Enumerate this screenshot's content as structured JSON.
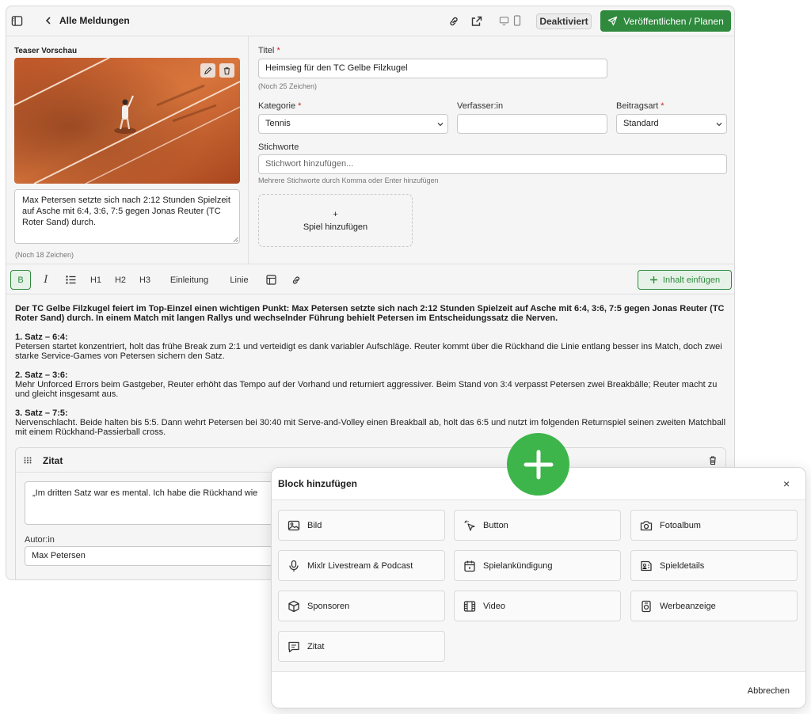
{
  "header": {
    "back_title": "Alle Meldungen",
    "deactivate_label": "Deaktiviert",
    "publish_label": "Veröffentlichen / Planen"
  },
  "teaser": {
    "heading": "Teaser Vorschau",
    "text": "Max Petersen setzte sich nach 2:12 Stunden Spielzeit auf Asche mit 6:4, 3:6, 7:5 gegen Jonas Reuter (TC Roter Sand) durch.",
    "remaining": "(Noch 18 Zeichen)"
  },
  "form": {
    "title_label": "Titel",
    "title_value": "Heimsieg für den TC Gelbe Filzkugel",
    "title_remaining": "(Noch 25 Zeichen)",
    "category_label": "Kategorie",
    "category_value": "Tennis",
    "author_label": "Verfasser:in",
    "author_value": "",
    "type_label": "Beitragsart",
    "type_value": "Standard",
    "tags_label": "Stichworte",
    "tags_placeholder": "Stichwort hinzufügen...",
    "tags_hint": "Mehrere Stichworte durch Komma oder Enter hinzufügen",
    "add_game_plus": "+",
    "add_game_label": "Spiel hinzufügen"
  },
  "toolbar": {
    "bold": "B",
    "italic": "I",
    "h1": "H1",
    "h2": "H2",
    "h3": "H3",
    "intro": "Einleitung",
    "line": "Linie",
    "insert_content": "Inhalt einfügen"
  },
  "article": {
    "lead": "Der TC Gelbe Filzkugel feiert im Top-Einzel einen wichtigen Punkt: Max Petersen setzte sich nach 2:12 Stunden Spielzeit auf Asche mit 6:4, 3:6, 7:5 gegen Jonas Reuter (TC Roter Sand) durch. In einem Match mit langen Rallys und wechselnder Führung behielt Petersen im Entscheidungssatz die Nerven.",
    "set1_title": "1. Satz – 6:4:",
    "set1_text": "Petersen startet konzentriert, holt das frühe Break zum 2:1 und verteidigt es dank variabler Aufschläge. Reuter kommt über die Rückhand die Linie entlang besser ins Match, doch zwei starke Service-Games von Petersen sichern den Satz.",
    "set2_title": "2. Satz – 3:6:",
    "set2_text": "Mehr Unforced Errors beim Gastgeber, Reuter erhöht das Tempo auf der Vorhand und returniert aggressiver. Beim Stand von 3:4 verpasst Petersen zwei Breakbälle; Reuter macht zu und gleicht insgesamt aus.",
    "set3_title": "3. Satz – 7:5:",
    "set3_text": "Nervenschlacht. Beide halten bis 5:5. Dann wehrt Petersen bei 30:40 mit Serve-and-Volley einen Breakball ab, holt das 6:5 und nutzt im folgenden Returnspiel seinen zweiten Matchball mit einem Rückhand-Passierball cross."
  },
  "quote_block": {
    "title": "Zitat",
    "text": "„Im dritten Satz war es mental. Ich habe die Rückhand wie",
    "author_label": "Autor:in",
    "author_value": "Max Petersen"
  },
  "modal": {
    "title": "Block hinzufügen",
    "close": "×",
    "cancel": "Abbrechen",
    "blocks": [
      {
        "label": "Bild",
        "icon": "image-icon"
      },
      {
        "label": "Button",
        "icon": "pointer-click-icon"
      },
      {
        "label": "Fotoalbum",
        "icon": "camera-icon"
      },
      {
        "label": "Mixlr Livestream & Podcast",
        "icon": "microphone-icon"
      },
      {
        "label": "Spielankündigung",
        "icon": "calendar-icon"
      },
      {
        "label": "Spieldetails",
        "icon": "details-icon"
      },
      {
        "label": "Sponsoren",
        "icon": "package-icon"
      },
      {
        "label": "Video",
        "icon": "film-icon"
      },
      {
        "label": "Werbeanzeige",
        "icon": "ad-icon"
      },
      {
        "label": "Zitat",
        "icon": "quote-bubble-icon"
      }
    ]
  },
  "colors": {
    "accent_green": "#2f8a3e",
    "plus_button_green": "#3db54a",
    "required_red": "#c62828"
  }
}
